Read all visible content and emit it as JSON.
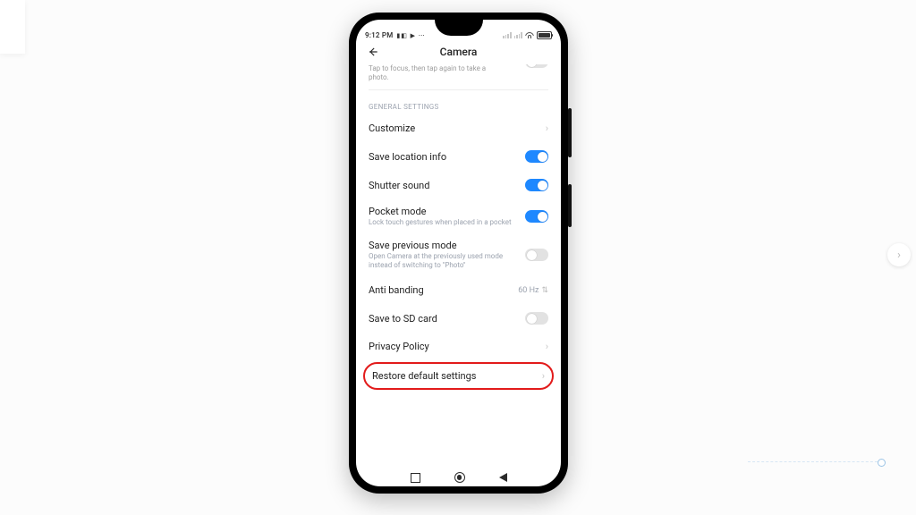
{
  "status": {
    "time": "9:12 PM",
    "left_icons": "▮◧ ▶ ⋯"
  },
  "header": {
    "title": "Camera"
  },
  "cutoff": {
    "line1": "Tap to focus, then tap again to take a",
    "line2": "photo."
  },
  "section_label": "GENERAL SETTINGS",
  "items": {
    "customize": {
      "label": "Customize"
    },
    "save_location": {
      "label": "Save location info",
      "on": true
    },
    "shutter_sound": {
      "label": "Shutter sound",
      "on": true
    },
    "pocket_mode": {
      "label": "Pocket mode",
      "desc": "Lock touch gestures when placed in a pocket",
      "on": true
    },
    "save_prev_mode": {
      "label": "Save previous mode",
      "desc": "Open Camera at the previously used mode instead of switching to \"Photo\"",
      "on": false
    },
    "anti_banding": {
      "label": "Anti banding",
      "value": "60 Hz"
    },
    "save_sd": {
      "label": "Save to SD card",
      "on": false
    },
    "privacy": {
      "label": "Privacy Policy"
    },
    "restore": {
      "label": "Restore default settings"
    }
  }
}
